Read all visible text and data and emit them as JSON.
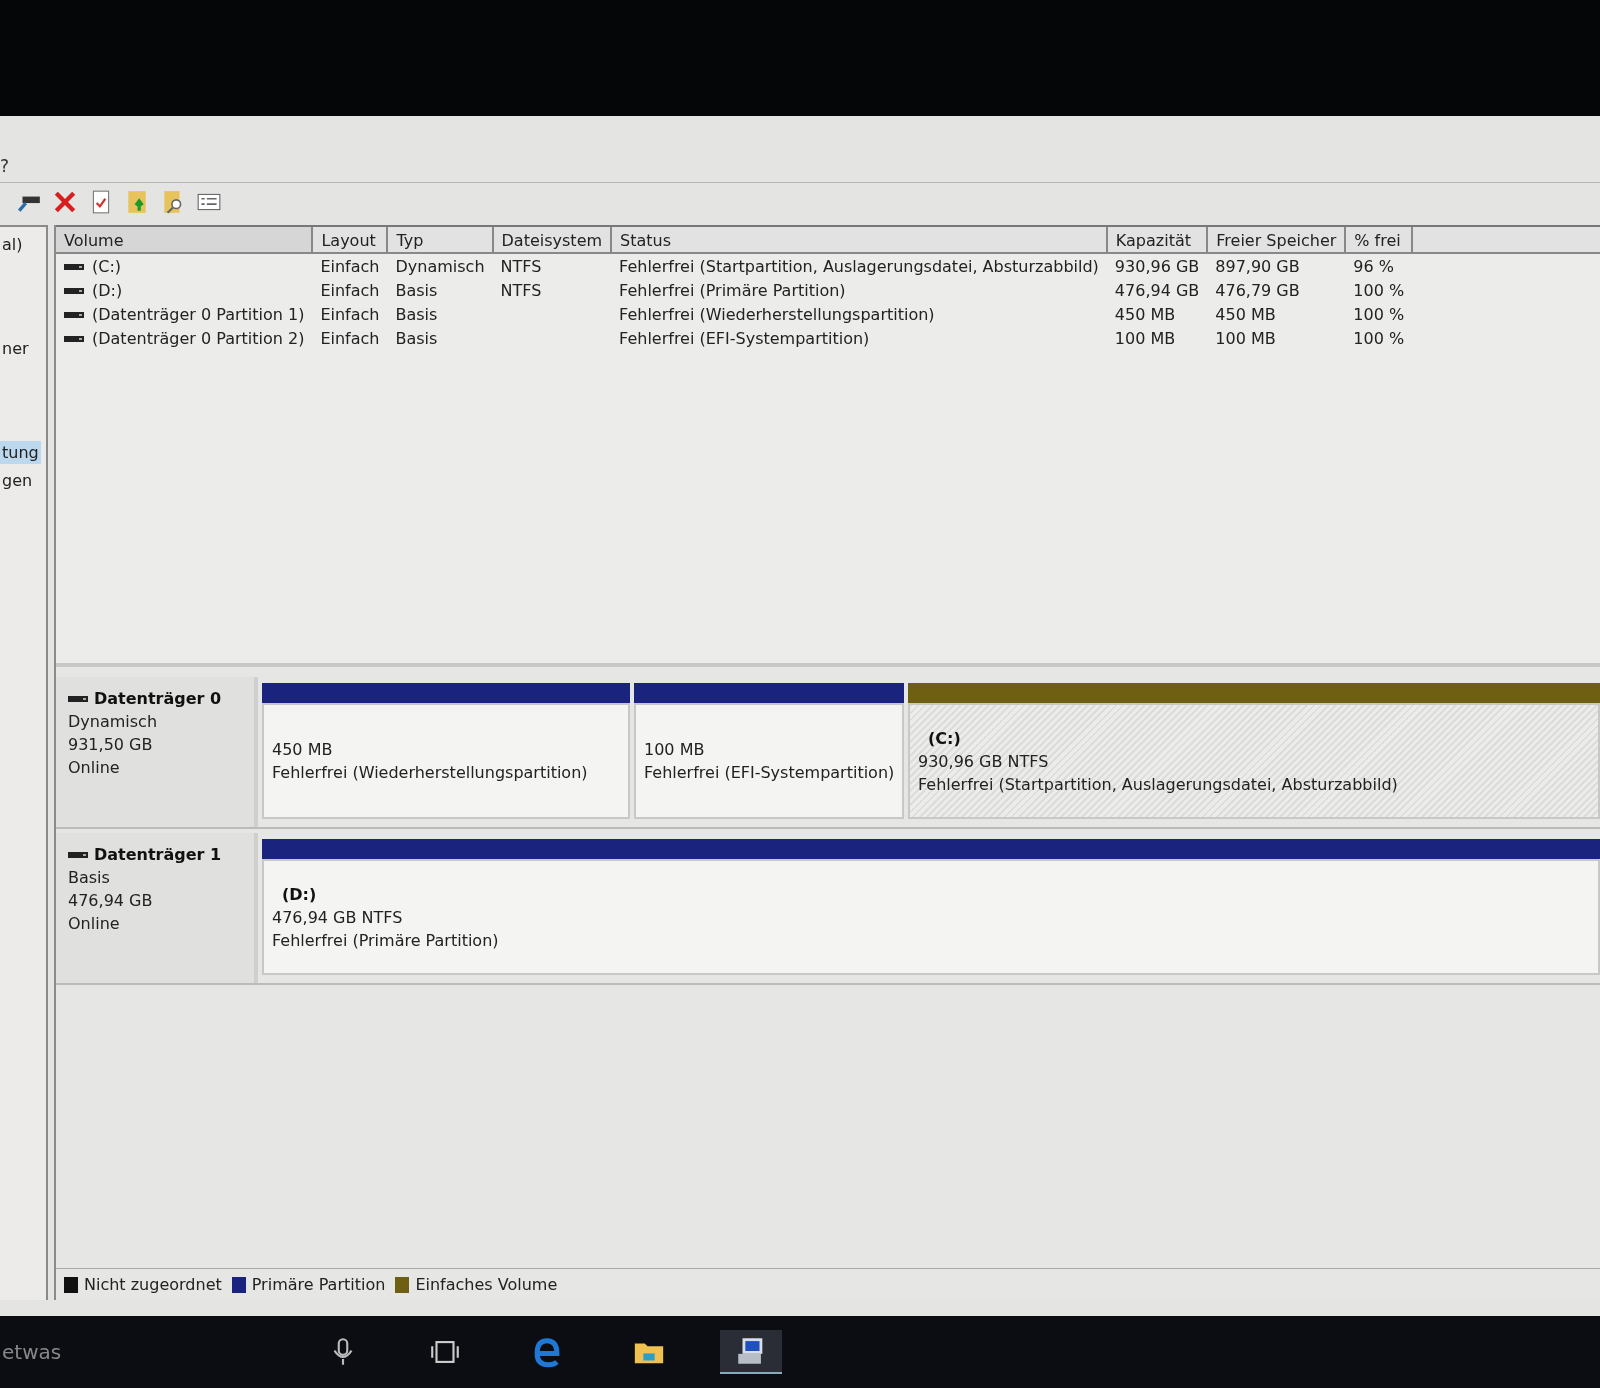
{
  "menu": [
    {
      "label": "?"
    }
  ],
  "sidebar": {
    "items": [
      {
        "label": "al)",
        "selected": false
      },
      {
        "label": "ner",
        "selected": false
      },
      {
        "label": "tung",
        "selected": true
      },
      {
        "label": "gen",
        "selected": false
      }
    ]
  },
  "table": {
    "columns": [
      "Volume",
      "Layout",
      "Typ",
      "Dateisystem",
      "Status",
      "Kapazität",
      "Freier Speicher",
      "% frei"
    ],
    "rows": [
      {
        "cells": [
          "(C:)",
          "Einfach",
          "Dynamisch",
          "NTFS",
          "Fehlerfrei (Startpartition, Auslagerungsdatei, Absturzabbild)",
          "930,96 GB",
          "897,90 GB",
          "96 %"
        ]
      },
      {
        "cells": [
          "(D:)",
          "Einfach",
          "Basis",
          "NTFS",
          "Fehlerfrei (Primäre Partition)",
          "476,94 GB",
          "476,79 GB",
          "100 %"
        ]
      },
      {
        "cells": [
          "(Datenträger 0 Partition 1)",
          "Einfach",
          "Basis",
          "",
          "Fehlerfrei (Wiederherstellungspartition)",
          "450 MB",
          "450 MB",
          "100 %"
        ]
      },
      {
        "cells": [
          "(Datenträger 0 Partition 2)",
          "Einfach",
          "Basis",
          "",
          "Fehlerfrei (EFI-Systempartition)",
          "100 MB",
          "100 MB",
          "100 %"
        ]
      }
    ]
  },
  "disks": [
    {
      "name": "Datenträger 0",
      "type": "Dynamisch",
      "size": "931,50 GB",
      "state": "Online",
      "partitions": [
        {
          "kind": "primary",
          "selected": false,
          "size": "450 MB",
          "status": "Fehlerfrei (Wiederherstellungspartition)"
        },
        {
          "kind": "primary",
          "selected": false,
          "size": "100 MB",
          "status": "Fehlerfrei (EFI-Systempartition)"
        },
        {
          "kind": "simple",
          "selected": true,
          "drive": "(C:)",
          "size": "930,96 GB NTFS",
          "status": "Fehlerfrei (Startpartition, Auslagerungsdatei, Absturzabbild)"
        }
      ]
    },
    {
      "name": "Datenträger 1",
      "type": "Basis",
      "size": "476,94 GB",
      "state": "Online",
      "partitions": [
        {
          "kind": "primary",
          "selected": false,
          "drive": "(D:)",
          "size": "476,94 GB NTFS",
          "status": "Fehlerfrei (Primäre Partition)"
        }
      ]
    }
  ],
  "legend": [
    {
      "kind": "unallocated",
      "label": "Nicht zugeordnet",
      "color": "#111111"
    },
    {
      "kind": "primary",
      "label": "Primäre Partition",
      "color": "#1a237e"
    },
    {
      "kind": "simple",
      "label": "Einfaches Volume",
      "color": "#6f5f12"
    }
  ],
  "taskbar": {
    "search_text": "etwas"
  }
}
